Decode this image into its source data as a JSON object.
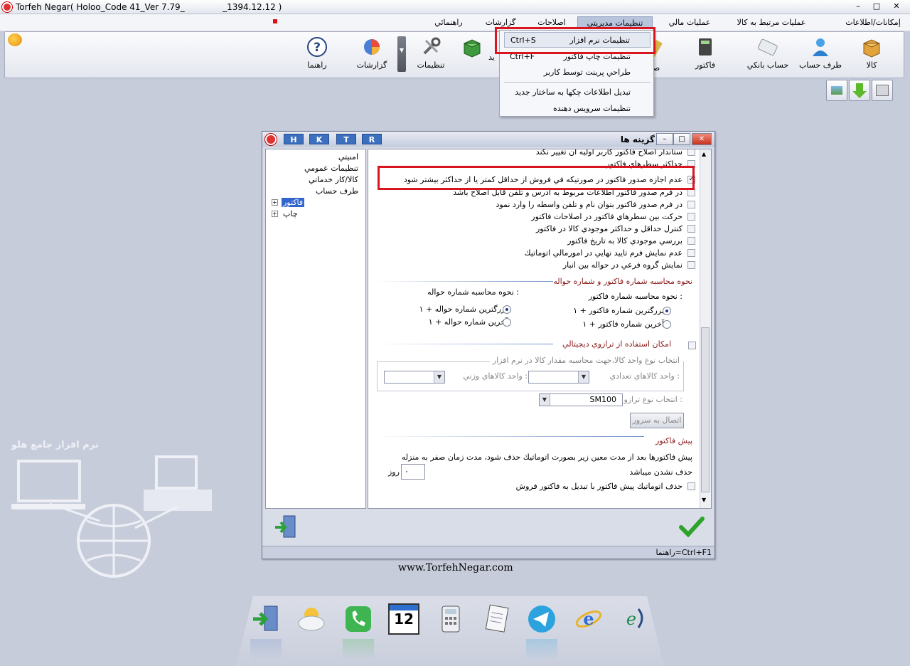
{
  "window": {
    "title": "Torfeh Negar( Holoo_Code 41_Ver 7.79_              _1394.12.12 )",
    "min": "–",
    "max": "□",
    "close": "✕"
  },
  "menu": [
    {
      "label": "إمكانات/اطلاعات پايه"
    },
    {
      "label": "عمليات مرتبط به كالا"
    },
    {
      "label": "عمليات مالي"
    },
    {
      "label": "تنظيمات مديريتي"
    },
    {
      "label": "اصلاحات"
    },
    {
      "label": "گزارشات"
    },
    {
      "label": "راهنمائي"
    }
  ],
  "toolbar": [
    {
      "label": "كالا"
    },
    {
      "label": "طرف حساب"
    },
    {
      "label": "حساب بانكي"
    },
    {
      "label": "فاكتور"
    },
    {
      "label": "صدو"
    },
    {
      "label": "يد"
    },
    {
      "label": "تنظيمات"
    },
    {
      "label": "گزارشات"
    },
    {
      "label": "راهنما"
    }
  ],
  "dropdown": [
    {
      "label": "تنظيمات نرم افزار",
      "shortcut": "Ctrl+S"
    },
    {
      "label": "تنظيمات چاپ فاكتور",
      "shortcut": "Ctrl+F"
    },
    {
      "label": "طراحي پرينت توسط كاربر",
      "shortcut": ""
    },
    {
      "label": "تبديل اطلاعات چكها به ساختار جديد",
      "shortcut": ""
    },
    {
      "label": "تنظيمات سرويس دهنده",
      "shortcut": ""
    }
  ],
  "dialog": {
    "title": "گزينه ها",
    "hotkeys": [
      "H",
      "K",
      "T",
      "R"
    ],
    "tree": [
      "امنيتي",
      "تنظيمات عمومي",
      "كالا/كار خدماتي",
      "طرف حساب",
      "فاكتور",
      "چاپ"
    ],
    "options": [
      {
        "label": "ستاندار اصلاح فاكتور كاربر اوليه آن تغيير نكند",
        "checked": false
      },
      {
        "label": "حداكثر سطرهاي فاكتور",
        "checked": false
      },
      {
        "label": "عدم اجازه صدور فاكتور در صورتيكه في فروش از حداقل كمتر يا از حداكثر بيشتر شود",
        "checked": true
      },
      {
        "label": "در فرم صدور فاكتور اطلاعات مربوط به آدرس و تلفن قابل اصلاح باشد",
        "checked": false
      },
      {
        "label": "در فرم صدور فاكتور بتوان نام و تلفن واسطه را وارد نمود",
        "checked": false
      },
      {
        "label": "حركت بين سطرهاي فاكتور در اصلاحات فاكتور",
        "checked": false
      },
      {
        "label": "كنترل حداقل و حداكثر موجودي كالا در فاكتور",
        "checked": false
      },
      {
        "label": "بررسي موجودي كالا به تاريخ فاكتور",
        "checked": false
      },
      {
        "label": "عدم نمايش فرم تاييد نهايي در امورمالي اتوماتيك",
        "checked": false
      },
      {
        "label": "نمايش گروه فرعي در حواله بين انبار",
        "checked": false
      }
    ],
    "numbering": {
      "section": "نحوه محاسبه شماره فاكتور و شماره حواله",
      "invoice_title": "نحوه محاسبه شماره فاكتور :",
      "invoice_opts": [
        "بزرگترين شماره فاكتور + ۱",
        "آخرين شماره فاكتور + ۱"
      ],
      "transfer_title": "نحوه محاسبه شماره حواله :",
      "transfer_opts": [
        "بزرگترين شماره حواله + ۱",
        "آخرين شماره حواله + ۱"
      ]
    },
    "scale": {
      "section": "امكان استفاده از ترازوي ديجيتالي",
      "group": "انتخاب نوع واحد كالا،جهت محاسبه مقدار كالا در نرم افزار",
      "count_unit": "واحد كالاهاي تعدادي :",
      "weight_unit": "واحد كالاهاي وزني :",
      "type_label": "انتخاب نوع ترازو :",
      "type_value": "SM100",
      "connect": "اتصال به سرور"
    },
    "preinvoice": {
      "section": "پيش فاكتور",
      "text1": "پيش فاكتورها بعد از مدت معين زير بصورت اتوماتيك حذف شود، مدت زمان صفر به منزله",
      "text2": "حذف نشدن ميباشد",
      "days_value": "۰",
      "days_unit": "روز",
      "auto_delete": "حذف اتوماتيك پيش فاكتور با تبديل به فاكتور فروش"
    },
    "status": "راهنما=Ctrl+F1"
  },
  "desktop": {
    "url": "www.TorfehNegar.com",
    "logo_text": "نرم افزار جامع هلو"
  },
  "dock": [
    "exit-icon",
    "weather-icon",
    "phone-icon",
    "calendar-icon",
    "calculator-icon",
    "notepad-icon",
    "telegram-icon",
    "ie-icon",
    "ecommerce-icon"
  ],
  "calendar_day": "12"
}
